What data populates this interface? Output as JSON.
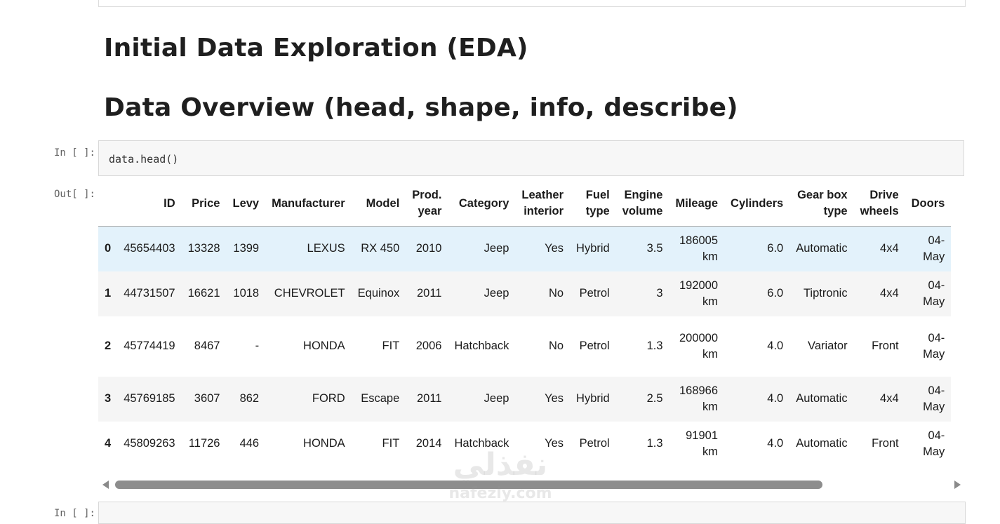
{
  "headings": {
    "h1": "Initial Data Exploration (EDA)",
    "h2": "Data Overview (head, shape, info, describe)"
  },
  "cells": {
    "input_prompt": "In [ ]:",
    "input_code": "data.head()",
    "output_prompt": "Out[ ]:",
    "next_prompt": "In [ ]:"
  },
  "table": {
    "columns": [
      {
        "l1": "",
        "l2": ""
      },
      {
        "l1": "",
        "l2": "ID"
      },
      {
        "l1": "",
        "l2": "Price"
      },
      {
        "l1": "",
        "l2": "Levy"
      },
      {
        "l1": "",
        "l2": "Manufacturer"
      },
      {
        "l1": "",
        "l2": "Model"
      },
      {
        "l1": "Prod.",
        "l2": "year"
      },
      {
        "l1": "",
        "l2": "Category"
      },
      {
        "l1": "Leather",
        "l2": "interior"
      },
      {
        "l1": "Fuel",
        "l2": "type"
      },
      {
        "l1": "Engine",
        "l2": "volume"
      },
      {
        "l1": "",
        "l2": "Mileage"
      },
      {
        "l1": "",
        "l2": "Cylinders"
      },
      {
        "l1": "Gear box",
        "l2": "type"
      },
      {
        "l1": "Drive",
        "l2": "wheels"
      },
      {
        "l1": "",
        "l2": "Doors"
      }
    ],
    "rows": [
      {
        "index": "0",
        "id": "45654403",
        "price": "13328",
        "levy": "1399",
        "manufacturer": "LEXUS",
        "model": "RX 450",
        "year": "2010",
        "category": "Jeep",
        "leather": "Yes",
        "fuel": "Hybrid",
        "engine": "3.5",
        "mileage_1": "186005",
        "mileage_2": "km",
        "cylinders": "6.0",
        "gearbox": "Automatic",
        "drive": "4x4",
        "doors_1": "04-",
        "doors_2": "May"
      },
      {
        "index": "1",
        "id": "44731507",
        "price": "16621",
        "levy": "1018",
        "manufacturer": "CHEVROLET",
        "model": "Equinox",
        "year": "2011",
        "category": "Jeep",
        "leather": "No",
        "fuel": "Petrol",
        "engine": "3",
        "mileage_1": "192000",
        "mileage_2": "km",
        "cylinders": "6.0",
        "gearbox": "Tiptronic",
        "drive": "4x4",
        "doors_1": "04-",
        "doors_2": "May"
      },
      {
        "index": "2",
        "id": "45774419",
        "price": "8467",
        "levy": "-",
        "manufacturer": "HONDA",
        "model": "FIT",
        "year": "2006",
        "category": "Hatchback",
        "leather": "No",
        "fuel": "Petrol",
        "engine": "1.3",
        "mileage_1": "200000",
        "mileage_2": "km",
        "cylinders": "4.0",
        "gearbox": "Variator",
        "drive": "Front",
        "doors_1": "04-",
        "doors_2": "May"
      },
      {
        "index": "3",
        "id": "45769185",
        "price": "3607",
        "levy": "862",
        "manufacturer": "FORD",
        "model": "Escape",
        "year": "2011",
        "category": "Jeep",
        "leather": "Yes",
        "fuel": "Hybrid",
        "engine": "2.5",
        "mileage_1": "168966",
        "mileage_2": "km",
        "cylinders": "4.0",
        "gearbox": "Automatic",
        "drive": "4x4",
        "doors_1": "04-",
        "doors_2": "May"
      },
      {
        "index": "4",
        "id": "45809263",
        "price": "11726",
        "levy": "446",
        "manufacturer": "HONDA",
        "model": "FIT",
        "year": "2014",
        "category": "Hatchback",
        "leather": "Yes",
        "fuel": "Petrol",
        "engine": "1.3",
        "mileage_1": "91901",
        "mileage_2": "km",
        "cylinders": "4.0",
        "gearbox": "Automatic",
        "drive": "Front",
        "doors_1": "04-",
        "doors_2": "May"
      }
    ]
  },
  "watermark": {
    "arabic": "نفذلي",
    "latin": "nafezly.com"
  },
  "colors": {
    "highlight_row": "#e3f2fb",
    "striped_row": "#f5f5f5",
    "scroll_thumb": "#8d8d8d"
  }
}
